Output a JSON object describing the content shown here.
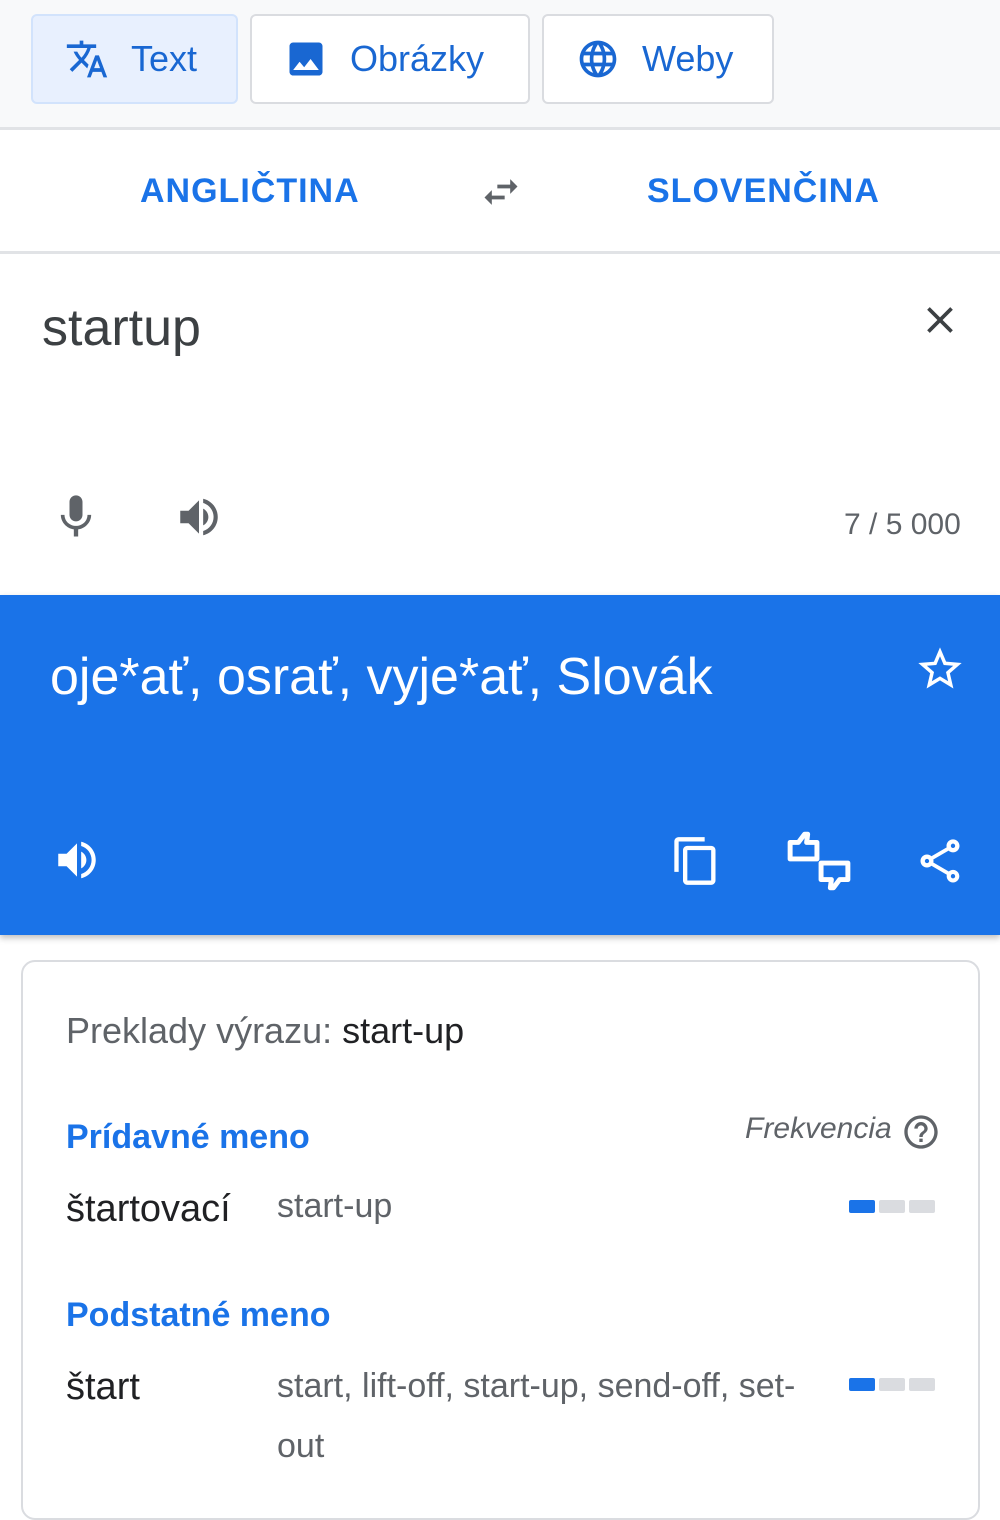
{
  "tabs": [
    {
      "label": "Text",
      "icon": "translate-icon",
      "active": true
    },
    {
      "label": "Obrázky",
      "icon": "image-icon",
      "active": false
    },
    {
      "label": "Weby",
      "icon": "globe-icon",
      "active": false
    }
  ],
  "languages": {
    "source": "ANGLIČTINA",
    "target": "SLOVENČINA"
  },
  "input": {
    "text": "startup",
    "char_count": "7 / 5 000"
  },
  "translation": {
    "text": "oje*ať, osrať, vyje*ať, Slovák"
  },
  "dictionary": {
    "title_prefix": "Preklady výrazu: ",
    "title_term": "start-up",
    "frequency_label": "Frekvencia",
    "groups": [
      {
        "part_of_speech": "Prídavné meno",
        "entries": [
          {
            "word": "štartovací",
            "synonyms": "start-up",
            "frequency": 1
          }
        ]
      },
      {
        "part_of_speech": "Podstatné meno",
        "entries": [
          {
            "word": "štart",
            "synonyms": "start, lift-off, start-up, send-off, set-out",
            "frequency": 1
          }
        ]
      }
    ]
  },
  "colors": {
    "accent": "#1a73e8",
    "tab_active_bg": "#e8f0fe"
  }
}
